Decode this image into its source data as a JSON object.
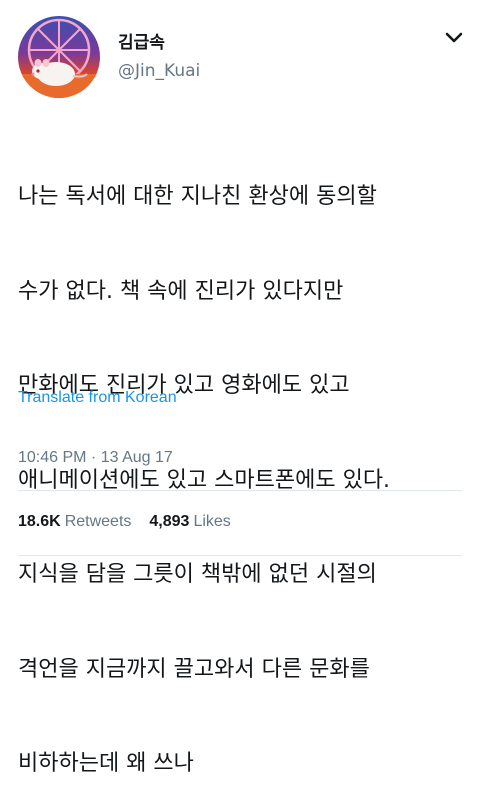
{
  "user": {
    "display_name": "김급속",
    "handle": "@Jin_Kuai",
    "avatar_icon": "avatar-hamster-photo"
  },
  "menu": {
    "icon": "chevron-down-icon"
  },
  "tweet": {
    "lines": [
      "나는 독서에 대한 지나친 환상에 동의할",
      "수가 없다. 책 속에 진리가 있다지만",
      "만화에도 진리가 있고 영화에도 있고",
      "애니메이션에도 있고 스마트폰에도 있다.",
      "지식을 담을 그릇이 책밖에 없던 시절의",
      "격언을 지금까지 끌고와서 다른 문화를",
      "비하하는데 왜 쓰나"
    ]
  },
  "translate": {
    "label": "Translate from Korean"
  },
  "meta": {
    "timestamp": "10:46 PM · 13 Aug 17"
  },
  "stats": {
    "retweets_count": "18.6K",
    "retweets_label": "Retweets",
    "likes_count": "4,893",
    "likes_label": "Likes"
  },
  "colors": {
    "link": "#1b95e0",
    "secondary_text": "#657786",
    "primary_text": "#14171a",
    "divider": "#e1e8ed"
  }
}
